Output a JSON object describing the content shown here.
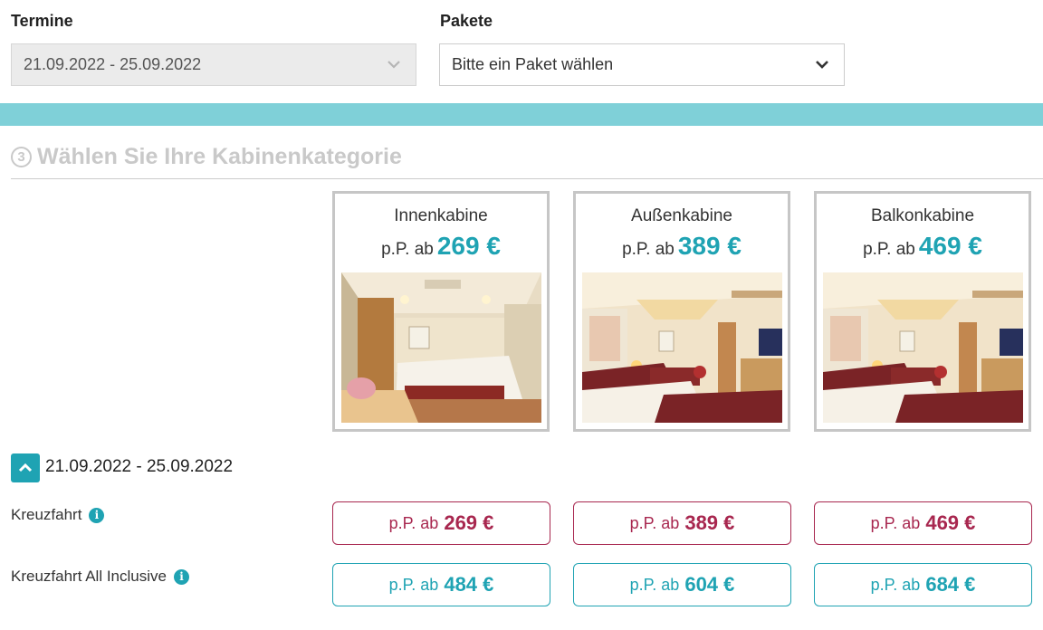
{
  "filters": {
    "termine_label": "Termine",
    "termine_value": "21.09.2022 - 25.09.2022",
    "pakete_label": "Pakete",
    "pakete_value": "Bitte ein Paket wählen"
  },
  "step": {
    "number": "3",
    "title": "Wählen Sie Ihre Kabinenkategorie"
  },
  "cabins": [
    {
      "name": "Innenkabine",
      "prefix": "p.P. ab",
      "price": "269 €"
    },
    {
      "name": "Außenkabine",
      "prefix": "p.P. ab",
      "price": "389 €"
    },
    {
      "name": "Balkonkabine",
      "prefix": "p.P. ab",
      "price": "469 €"
    }
  ],
  "date_group": {
    "date": "21.09.2022 - 25.09.2022",
    "rows": [
      {
        "label": "Kreuzfahrt",
        "prices": [
          {
            "prefix": "p.P. ab",
            "price": "269 €"
          },
          {
            "prefix": "p.P. ab",
            "price": "389 €"
          },
          {
            "prefix": "p.P. ab",
            "price": "469 €"
          }
        ]
      },
      {
        "label": "Kreuzfahrt All Inclusive",
        "prices": [
          {
            "prefix": "p.P. ab",
            "price": "484 €"
          },
          {
            "prefix": "p.P. ab",
            "price": "604 €"
          },
          {
            "prefix": "p.P. ab",
            "price": "684 €"
          }
        ]
      }
    ]
  },
  "colors": {
    "accent_teal": "#1fa3b3",
    "bar_teal": "#7fd0d8",
    "cruise_red": "#a8274f"
  },
  "icons": [
    "chevron-down-icon",
    "chevron-up-icon",
    "info-icon",
    "step-number-circle"
  ]
}
